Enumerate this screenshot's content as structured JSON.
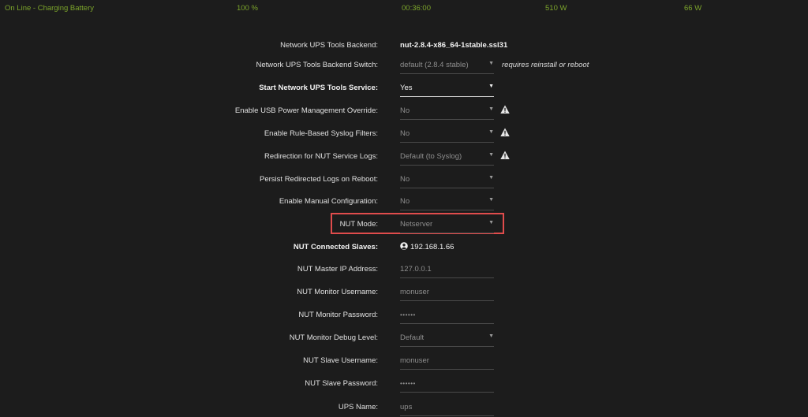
{
  "status": {
    "state": "On Line - Charging Battery",
    "charge": "100 %",
    "runtime": "00:36:00",
    "load": "510 W",
    "nominal": "66 W"
  },
  "settings": {
    "backend": {
      "label": "Network UPS Tools Backend:",
      "value": "nut-2.8.4-x86_64-1stable.ssl31"
    },
    "backend_switch": {
      "label": "Network UPS Tools Backend Switch:",
      "value": "default (2.8.4 stable)",
      "note": "requires reinstall or reboot"
    },
    "start_service": {
      "label": "Start Network UPS Tools Service:",
      "value": "Yes"
    },
    "usb_override": {
      "label": "Enable USB Power Management Override:",
      "value": "No"
    },
    "syslog_filters": {
      "label": "Enable Rule-Based Syslog Filters:",
      "value": "No"
    },
    "log_redirection": {
      "label": "Redirection for NUT Service Logs:",
      "value": "Default (to Syslog)"
    },
    "persist_logs": {
      "label": "Persist Redirected Logs on Reboot:",
      "value": "No"
    },
    "manual_config": {
      "label": "Enable Manual Configuration:",
      "value": "No"
    },
    "nut_mode": {
      "label": "NUT Mode:",
      "value": "Netserver"
    },
    "connected_slaves": {
      "label": "NUT Connected Slaves:",
      "value": "192.168.1.66"
    },
    "master_ip": {
      "label": "NUT Master IP Address:",
      "value": "127.0.0.1"
    },
    "monitor_username": {
      "label": "NUT Monitor Username:",
      "value": "monuser"
    },
    "monitor_password": {
      "label": "NUT Monitor Password:",
      "value": "••••••"
    },
    "monitor_debug": {
      "label": "NUT Monitor Debug Level:",
      "value": "Default"
    },
    "slave_username": {
      "label": "NUT Slave Username:",
      "value": "monuser"
    },
    "slave_password": {
      "label": "NUT Slave Password:",
      "value": "••••••"
    },
    "ups_name": {
      "label": "UPS Name:",
      "value": "ups"
    }
  },
  "icons": {
    "warning": "warning-icon",
    "user": "user-circle-icon",
    "dropdown": "chevron-down-icon"
  },
  "colors": {
    "status_text": "#7ca52b",
    "highlight": "#e04c4c",
    "background": "#1c1c1c"
  }
}
